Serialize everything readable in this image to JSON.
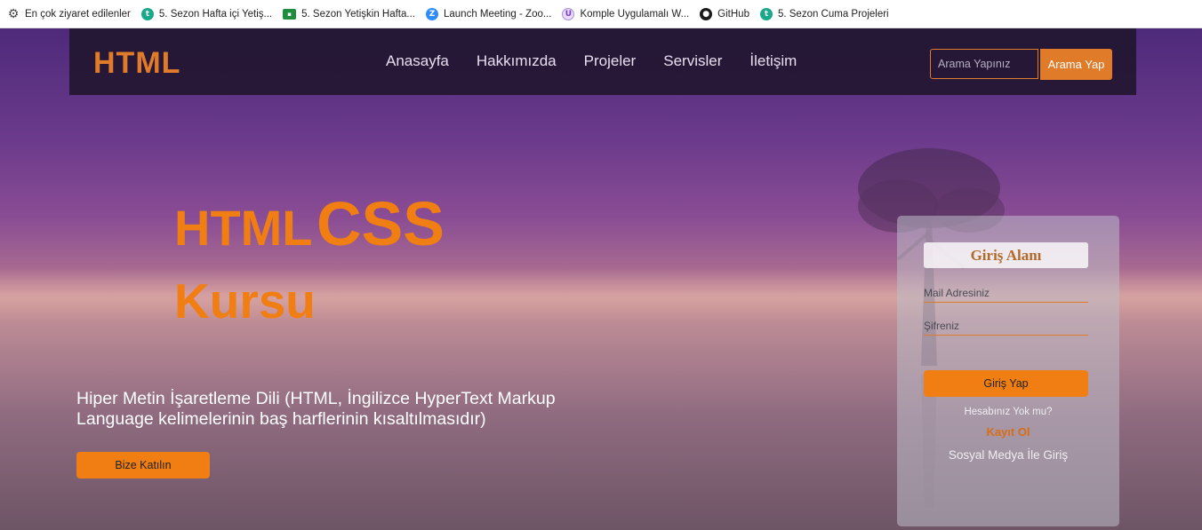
{
  "bookmarks": [
    {
      "label": "En çok ziyaret edilenler",
      "icon": "gear-icon"
    },
    {
      "label": "5. Sezon Hafta içi Yetiş...",
      "icon": "t-icon"
    },
    {
      "label": "5. Sezon Yetişkin Hafta...",
      "icon": "classroom-icon"
    },
    {
      "label": "Launch Meeting - Zoo...",
      "icon": "zoom-icon"
    },
    {
      "label": "Komple Uygulamalı W...",
      "icon": "udemy-icon"
    },
    {
      "label": "GitHub",
      "icon": "github-icon"
    },
    {
      "label": "5. Sezon Cuma Projeleri",
      "icon": "t-icon"
    }
  ],
  "nav": {
    "logo": "HTML",
    "items": [
      "Anasayfa",
      "Hakkımızda",
      "Projeler",
      "Servisler",
      "İletişim"
    ],
    "search_placeholder": "Arama Yapınız",
    "search_button": "Arama Yap"
  },
  "hero": {
    "title_part1": "HTML",
    "title_part2": "CSS",
    "title_part3": "Kursu",
    "description": "Hiper Metin İşaretleme Dili (HTML, İngilizce HyperText Markup Language kelimelerinin baş harflerinin kısaltılmasıdır)",
    "join_button": "Bize Katılın"
  },
  "login": {
    "title": "Giriş Alanı",
    "mail_placeholder": "Mail Adresiniz",
    "password_placeholder": "Şifreniz",
    "submit": "Giriş Yap",
    "no_account": "Hesabınız Yok mu?",
    "signup": "Kayıt Ol",
    "social": "Sosyal Medya İle Giriş"
  },
  "colors": {
    "accent": "#f07e12",
    "navbar": "#221630",
    "panel": "#bebec8"
  }
}
